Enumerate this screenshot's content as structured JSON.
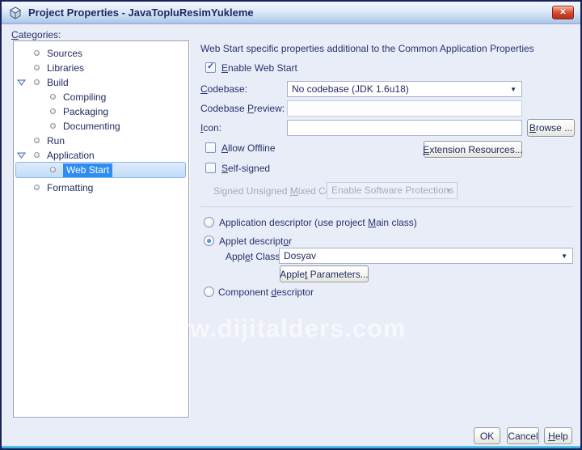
{
  "window": {
    "title": "Project Properties - JavaTopluResimYukleme"
  },
  "icons": {
    "close": "✕",
    "dropdown_arrow": "▼",
    "checkmark": "✓"
  },
  "sidebar": {
    "label": {
      "key": "C",
      "post": "ategories:"
    },
    "items": [
      {
        "label": "Sources",
        "level": 1
      },
      {
        "label": "Libraries",
        "level": 1
      },
      {
        "label": "Build",
        "level": 1,
        "expanded": true
      },
      {
        "label": "Compiling",
        "level": 2
      },
      {
        "label": "Packaging",
        "level": 2
      },
      {
        "label": "Documenting",
        "level": 2
      },
      {
        "label": "Run",
        "level": 1
      },
      {
        "label": "Application",
        "level": 1,
        "expanded": true
      },
      {
        "label": "Web Start",
        "level": 2,
        "selected": true
      },
      {
        "label": "Formatting",
        "level": 1
      }
    ]
  },
  "main": {
    "header": "Web Start specific properties additional to the Common Application Properties",
    "enable_web_start": {
      "key": "E",
      "post": "nable Web Start",
      "checked": true
    },
    "codebase": {
      "label": {
        "key": "C",
        "post": "odebase:"
      },
      "value": "No codebase (JDK 1.6u18)"
    },
    "codebase_preview": {
      "label": {
        "pre": "Codebase ",
        "key": "P",
        "post": "review:"
      },
      "value": ""
    },
    "icon_row": {
      "label": {
        "key": "I",
        "post": "con:"
      },
      "value": "",
      "browse": {
        "key": "B",
        "post": "rowse ..."
      }
    },
    "allow_offline": {
      "key": "A",
      "post": "llow Offline",
      "checked": false
    },
    "extension_resources": {
      "key": "E",
      "post": "xtension Resources..."
    },
    "self_signed": {
      "key": "S",
      "post": "elf-signed",
      "checked": false
    },
    "mixed_code": {
      "label": {
        "pre": "Signed Unsigned ",
        "key": "M",
        "post": "ixed Code:"
      },
      "value": "Enable Software Protections",
      "disabled": true
    },
    "descriptor": {
      "application": {
        "pre": "Application descriptor (use project ",
        "key": "M",
        "post": "ain class)",
        "selected": false
      },
      "applet": {
        "pre": "Applet descript",
        "key": "o",
        "post": "r",
        "selected": true
      },
      "applet_class": {
        "label": {
          "pre": "Appl",
          "key": "e",
          "post": "t Class:"
        },
        "value": "Dosyav"
      },
      "applet_parameters": {
        "pre": "Apple",
        "key": "t",
        "post": " Parameters..."
      },
      "component": {
        "pre": "Component ",
        "key": "d",
        "post": "escriptor",
        "selected": false
      }
    }
  },
  "watermark": "www.dijitalders.com",
  "footer": {
    "ok_label": "OK",
    "cancel_label": "Cancel",
    "help": {
      "key": "H",
      "post": "elp"
    }
  }
}
